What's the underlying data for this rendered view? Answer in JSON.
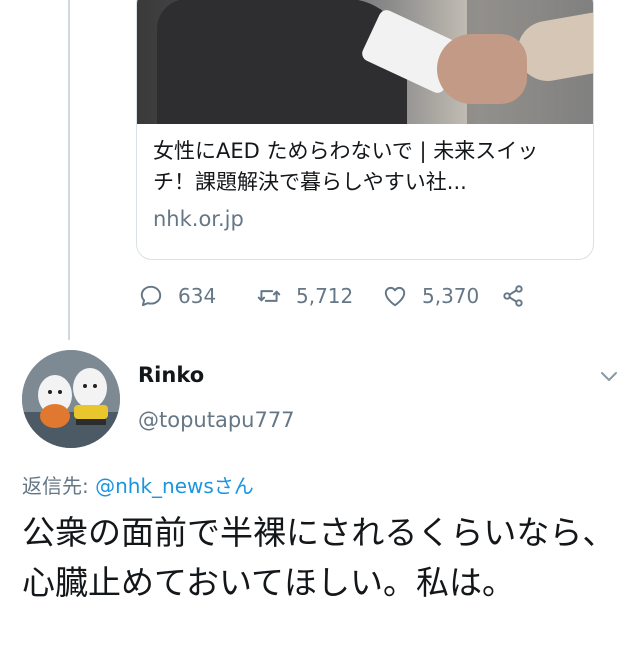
{
  "link_card": {
    "title": "女性にAED ためらわないで | 未来スイッチ！課題解決で暮らしやすい社...",
    "domain": "nhk.or.jp"
  },
  "actions": {
    "reply_count": "634",
    "retweet_count": "5,712",
    "like_count": "5,370",
    "icons": [
      "comment-icon",
      "retweet-icon",
      "heart-icon",
      "share-icon"
    ]
  },
  "reply": {
    "display_name": "Rinko",
    "handle": "@toputapu777",
    "replying_label": "返信先: ",
    "replying_mention": "@nhk_newsさん",
    "text": "公衆の面前で半裸にされるくらいなら、心臓止めておいてほしい。私は。"
  },
  "colors": {
    "text_primary": "#14171a",
    "text_secondary": "#657786",
    "link": "#1b95e0",
    "border": "#d9e1e6"
  }
}
